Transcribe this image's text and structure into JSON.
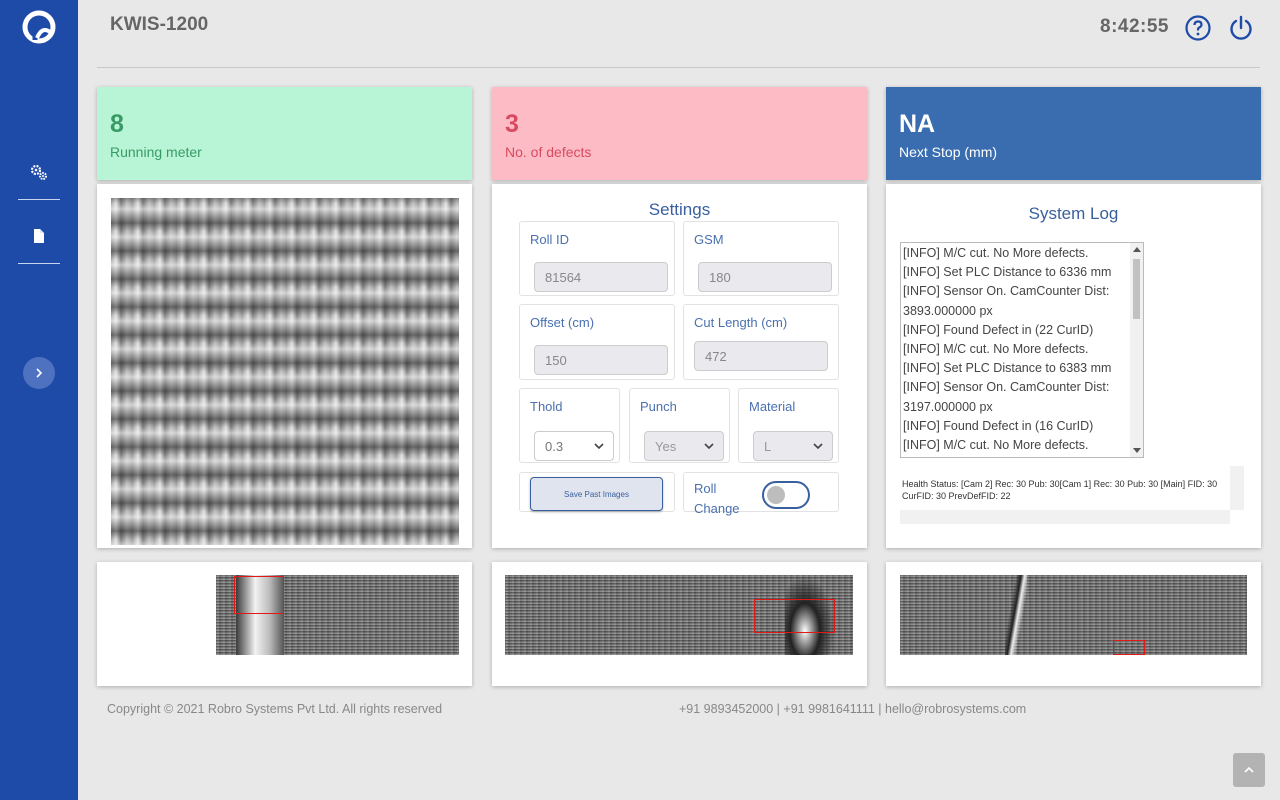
{
  "header": {
    "title": "KWIS-1200",
    "clock": "8:42:55",
    "help_icon": "help-circle-icon",
    "power_icon": "power-icon"
  },
  "sidebar": {
    "logo_icon": "robro-logo-icon",
    "items": [
      {
        "icon": "gears-icon"
      },
      {
        "icon": "document-icon"
      }
    ],
    "expand_icon": "chevron-right-icon"
  },
  "stats": {
    "running_meter": {
      "value": "8",
      "label": "Running meter"
    },
    "defects": {
      "value": "3",
      "label": "No. of defects"
    },
    "next_stop": {
      "value": "NA",
      "label": "Next Stop (mm)"
    }
  },
  "settings": {
    "title": "Settings",
    "roll_id": {
      "label": "Roll ID",
      "value": "81564"
    },
    "gsm": {
      "label": "GSM",
      "value": "180"
    },
    "offset": {
      "label": "Offset (cm)",
      "value": "150"
    },
    "cut_length": {
      "label": "Cut Length (cm)",
      "value": "472"
    },
    "thold": {
      "label": "Thold",
      "value": "0.3"
    },
    "punch": {
      "label": "Punch",
      "value": "Yes"
    },
    "material": {
      "label": "Material",
      "value": "L"
    },
    "save_button": "Save Past Images",
    "roll_change": {
      "label_line1": "Roll",
      "label_line2": "Change",
      "on": false
    }
  },
  "system_log": {
    "title": "System Log",
    "lines": [
      "[INFO] M/C cut. No More defects.",
      "[INFO] Set PLC Distance to 6336 mm",
      "[INFO] Sensor On. CamCounter Dist: 3893.000000 px",
      "[INFO] Found Defect in (22 CurID)",
      "[INFO] M/C cut. No More defects.",
      "[INFO] Set PLC Distance to 6383 mm",
      "[INFO] Sensor On. CamCounter Dist: 3197.000000 px",
      "[INFO] Found Defect in (16 CurID)",
      "[INFO] M/C cut. No More defects."
    ],
    "health_status": "Health Status: [Cam 2] Rec: 30 Pub: 30[Cam 1] Rec: 30 Pub: 30 [Main] FID: 30 CurFID: 30 PrevDefFID: 22"
  },
  "footer": {
    "copyright": "Copyright © 2021 Robro Systems Pvt Ltd. All rights reserved",
    "contact": "+91 9893452000 | +91 9981641111 | hello@robrosystems.com",
    "scroll_top_icon": "chevron-up-icon"
  },
  "colors": {
    "sidebar": "#1e4aa8",
    "running_meter_bg": "#b8f5d6",
    "defects_bg": "#fdbcc5",
    "next_stop_bg": "#3a6db0",
    "accent": "#3a5f9e",
    "defect_marker": "#e01818"
  }
}
